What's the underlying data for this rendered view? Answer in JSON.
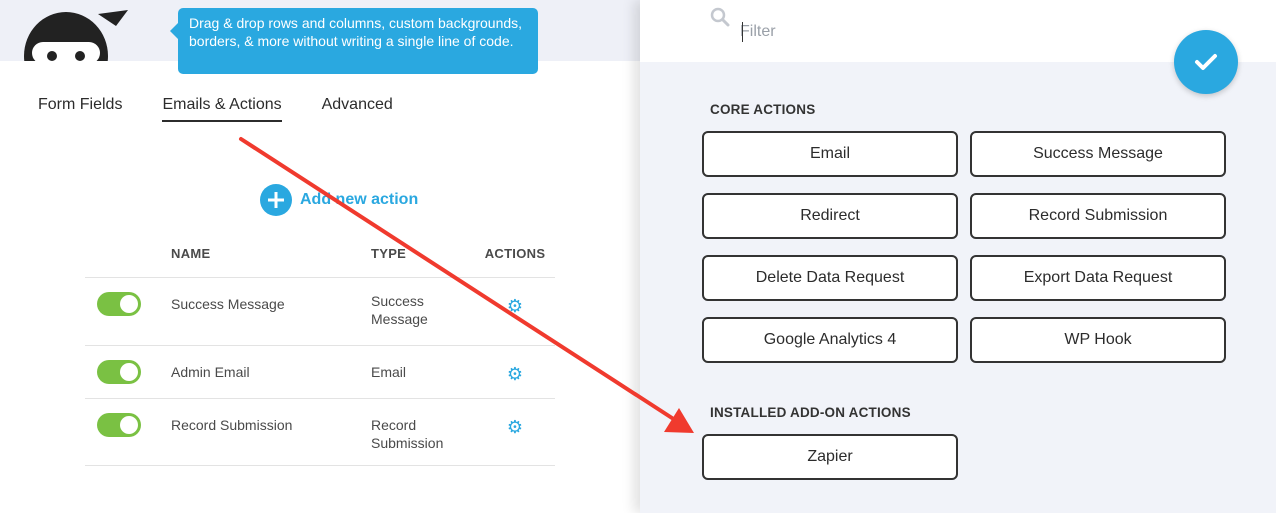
{
  "tooltip": "Drag & drop rows and columns, custom backgrounds, borders, & more without writing a single line of code.",
  "tabs": [
    {
      "label": "Form Fields"
    },
    {
      "label": "Emails & Actions"
    },
    {
      "label": "Advanced"
    }
  ],
  "add_action_label": "Add new action",
  "table": {
    "headers": {
      "name": "NAME",
      "type": "TYPE",
      "actions": "ACTIONS"
    },
    "rows": [
      {
        "name": "Success Message",
        "type": "Success Message",
        "enabled": true
      },
      {
        "name": "Admin Email",
        "type": "Email",
        "enabled": true
      },
      {
        "name": "Record Submission",
        "type": "Record Submission",
        "enabled": true
      }
    ]
  },
  "panel": {
    "filter_placeholder": "Filter",
    "core_title": "CORE ACTIONS",
    "core_actions": [
      "Email",
      "Success Message",
      "Redirect",
      "Record Submission",
      "Delete Data Request",
      "Export Data Request",
      "Google Analytics 4",
      "WP Hook"
    ],
    "addon_title": "INSTALLED ADD-ON ACTIONS",
    "addon_actions": [
      "Zapier"
    ]
  },
  "colors": {
    "accent": "#2aa8e0",
    "toggle_on": "#7ac143",
    "annotation_arrow": "#f03a2e"
  },
  "icons": [
    "ninja-logo-icon",
    "plus-circle-icon",
    "gear-icon",
    "search-icon",
    "checkmark-icon"
  ]
}
